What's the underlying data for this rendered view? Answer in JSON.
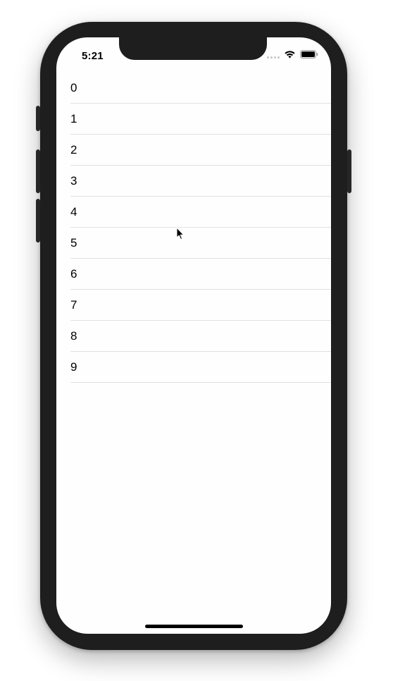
{
  "status_bar": {
    "time": "5:21"
  },
  "list": {
    "items": [
      {
        "label": "0"
      },
      {
        "label": "1"
      },
      {
        "label": "2"
      },
      {
        "label": "3"
      },
      {
        "label": "4"
      },
      {
        "label": "5"
      },
      {
        "label": "6"
      },
      {
        "label": "7"
      },
      {
        "label": "8"
      },
      {
        "label": "9"
      }
    ]
  },
  "icons": {
    "wifi": "wifi-icon",
    "battery": "battery-icon",
    "signal": "cellular-signal-icon",
    "cursor": "mouse-pointer-icon"
  },
  "colors": {
    "frame": "#1e1e1e",
    "screen_bg": "#fefefe",
    "separator": "#e1e1e6",
    "text": "#000000"
  }
}
